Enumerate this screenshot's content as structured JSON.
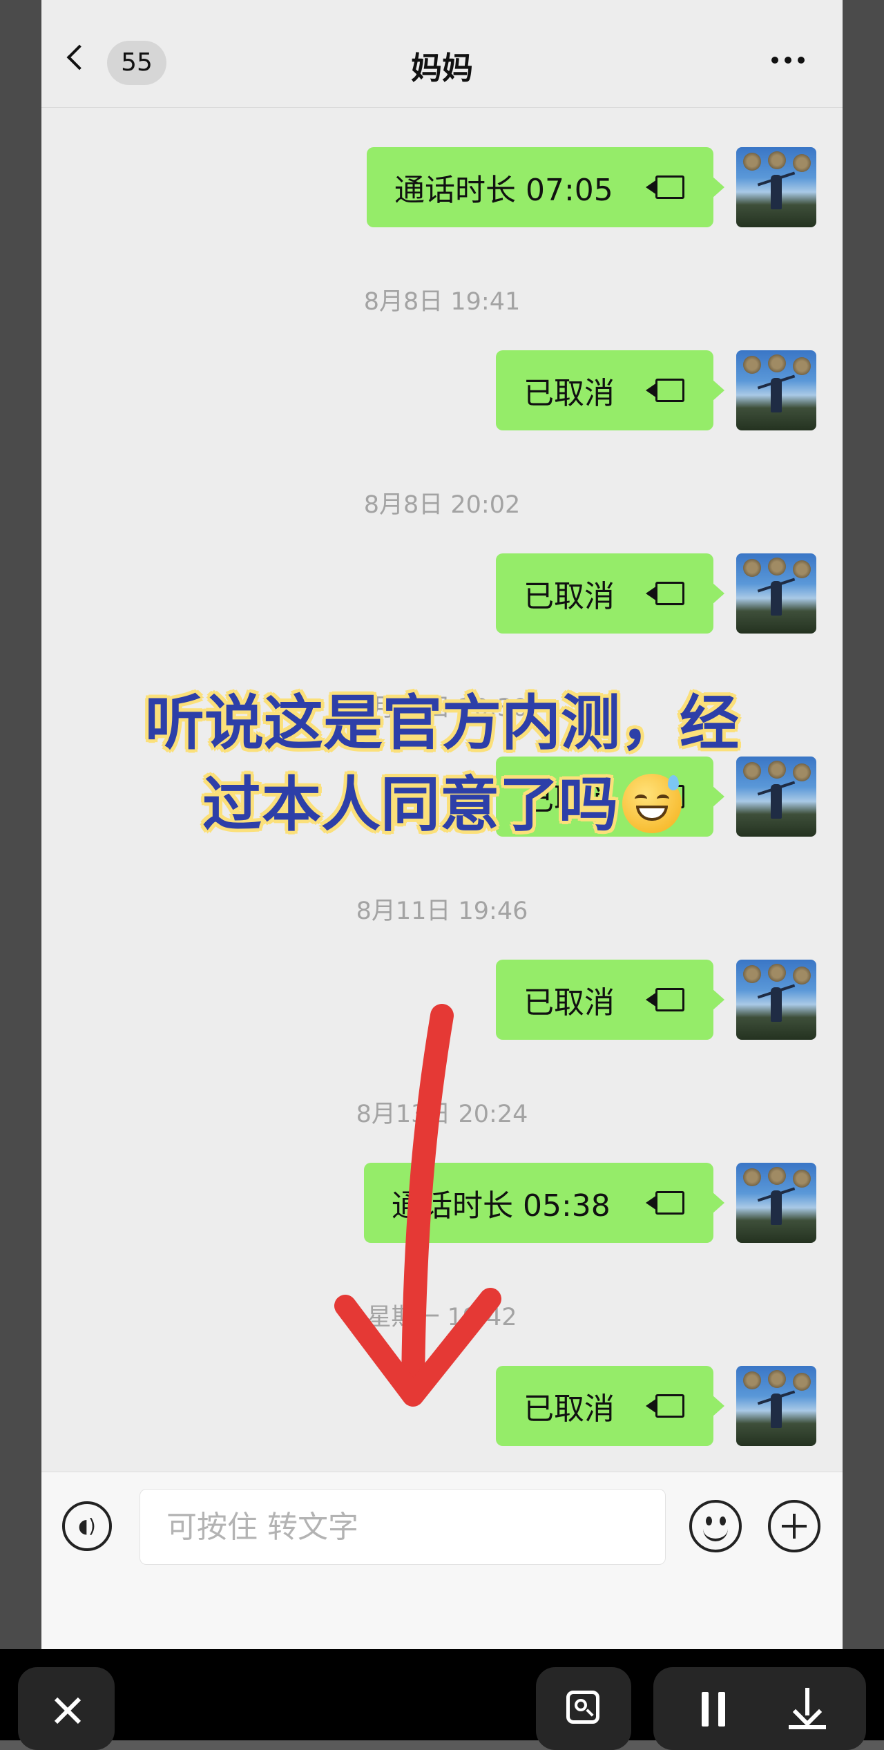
{
  "header": {
    "unread_count": "55",
    "title": "妈妈"
  },
  "messages": [
    {
      "type": "call",
      "text": "通话时长 07:05",
      "icon": "video-call-icon"
    },
    {
      "type": "timestamp",
      "text": "8月8日 19:41"
    },
    {
      "type": "call",
      "text": "已取消",
      "icon": "video-call-icon"
    },
    {
      "type": "timestamp",
      "text": "8月8日 20:02"
    },
    {
      "type": "call",
      "text": "已取消",
      "icon": "video-call-icon"
    },
    {
      "type": "timestamp",
      "text": "8月10日 20:30"
    },
    {
      "type": "call",
      "text": "已取消",
      "icon": "video-call-icon"
    },
    {
      "type": "timestamp",
      "text": "8月11日 19:46"
    },
    {
      "type": "call",
      "text": "已取消",
      "icon": "video-call-icon"
    },
    {
      "type": "timestamp",
      "text": "8月13日 20:24"
    },
    {
      "type": "call",
      "text": "通话时长 05:38",
      "icon": "video-call-icon"
    },
    {
      "type": "timestamp",
      "text": "星期一 19:42"
    },
    {
      "type": "call",
      "text": "已取消",
      "icon": "video-call-icon"
    }
  ],
  "input": {
    "placeholder": "可按住 转文字"
  },
  "overlay": {
    "caption_line1": "听说这是官方内测，经",
    "caption_line2": "过本人同意了吗",
    "caption_emoji": "sweat-smile-emoji"
  },
  "colors": {
    "bubble_green": "#95ec69",
    "caption_text": "#2d3fa8",
    "caption_outline": "#fbe07a",
    "arrow_red": "#e53935"
  }
}
